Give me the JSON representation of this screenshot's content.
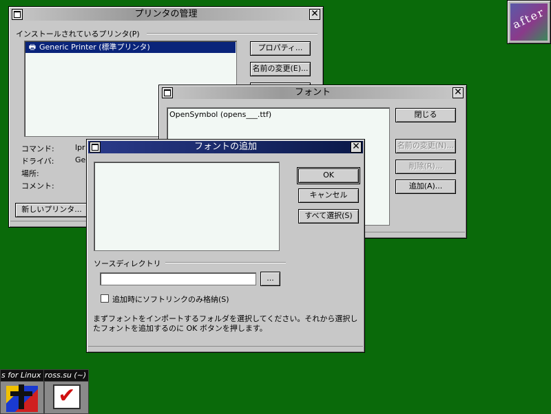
{
  "printer_manager": {
    "title": "プリンタの管理",
    "installed_label": "インストールされているプリンタ(P)",
    "printers": [
      "Generic Printer (標準プリンタ)"
    ],
    "properties_button": "プロパティ...",
    "rename_button": "名前の変更(E)...",
    "fields": {
      "command_label": "コマンド:",
      "command_value": "lpr",
      "driver_label": "ドライバ:",
      "driver_value": "Gen",
      "location_label": "場所:",
      "comment_label": "コメント:"
    },
    "new_printer_button": "新しいプリンタ..."
  },
  "fonts_window": {
    "title": "フォント",
    "fonts": [
      "OpenSymbol (opens___.ttf)"
    ],
    "close_button": "閉じる",
    "rename_button": "名前の変更(N)...",
    "delete_button": "削除(R)...",
    "add_button": "追加(A)..."
  },
  "add_font_dialog": {
    "title": "フォントの追加",
    "ok_button": "OK",
    "cancel_button": "キャンセル",
    "select_all_button": "すべて選択(S)",
    "source_dir_label": "ソースディレクトリ",
    "source_dir_value": "",
    "browse_button": "...",
    "softlink_checkbox_label": "追加時にソフトリンクのみ格納(S)",
    "softlink_checked": false,
    "instructions_line1": "まずフォントをインポートするフォルダを選択してください。それから選択し",
    "instructions_line2": "たフォントを追加するのに OK ボタンを押します。"
  },
  "taskbar": {
    "items": [
      "s for Linux",
      "ross.su (~)"
    ]
  },
  "desktop": {
    "afterstep_logo": "after"
  }
}
